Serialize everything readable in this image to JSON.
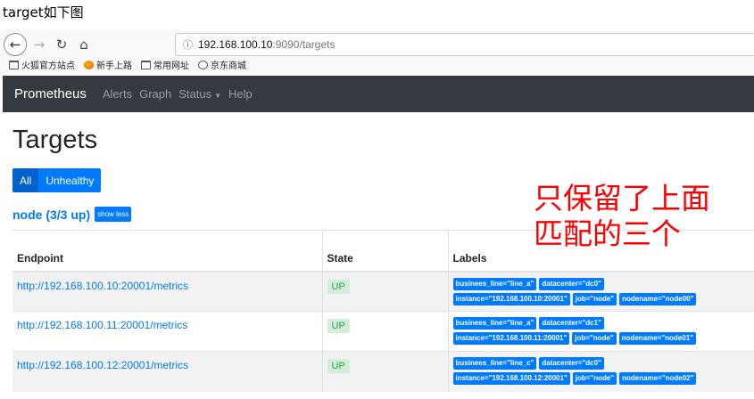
{
  "caption": "target如下图",
  "browser": {
    "back_icon": "arrow-left-icon",
    "forward_icon": "arrow-right-icon",
    "reload_icon": "reload-icon",
    "home_icon": "home-icon",
    "url_host": "192.168.100.10",
    "url_path": ":9090/targets",
    "bookmarks": [
      {
        "label": "火狐官方站点",
        "icon": "folder-icon"
      },
      {
        "label": "新手上路",
        "icon": "firefox-icon"
      },
      {
        "label": "常用网址",
        "icon": "folder-icon"
      },
      {
        "label": "京东商城",
        "icon": "globe-icon"
      }
    ]
  },
  "navbar": {
    "brand": "Prometheus",
    "links": [
      "Alerts",
      "Graph",
      "Status",
      "Help"
    ]
  },
  "page": {
    "title": "Targets",
    "filters": {
      "all": "All",
      "unhealthy": "Unhealthy"
    },
    "job": {
      "name": "node (3/3 up)",
      "toggle": "show less"
    }
  },
  "table": {
    "headers": {
      "endpoint": "Endpoint",
      "state": "State",
      "labels": "Labels"
    },
    "rows": [
      {
        "endpoint": "http://192.168.100.10:20001/metrics",
        "state": "UP",
        "labels_line1": [
          "businees_line=\"line_a\"",
          "datacenter=\"dc0\""
        ],
        "labels_line2": [
          "instance=\"192.168.100.10:20001\"",
          "job=\"node\"",
          "nodename=\"node00\""
        ]
      },
      {
        "endpoint": "http://192.168.100.11:20001/metrics",
        "state": "UP",
        "labels_line1": [
          "businees_line=\"line_a\"",
          "datacenter=\"dc1\""
        ],
        "labels_line2": [
          "instance=\"192.168.100.11:20001\"",
          "job=\"node\"",
          "nodename=\"node01\""
        ]
      },
      {
        "endpoint": "http://192.168.100.12:20001/metrics",
        "state": "UP",
        "labels_line1": [
          "businees_line=\"line_c\"",
          "datacenter=\"dc0\""
        ],
        "labels_line2": [
          "instance=\"192.168.100.12:20001\"",
          "job=\"node\"",
          "nodename=\"node02\""
        ]
      }
    ]
  },
  "annotation": {
    "line1": "只保留了上面",
    "line2": "匹配的三个",
    "color": "#ff0000"
  }
}
